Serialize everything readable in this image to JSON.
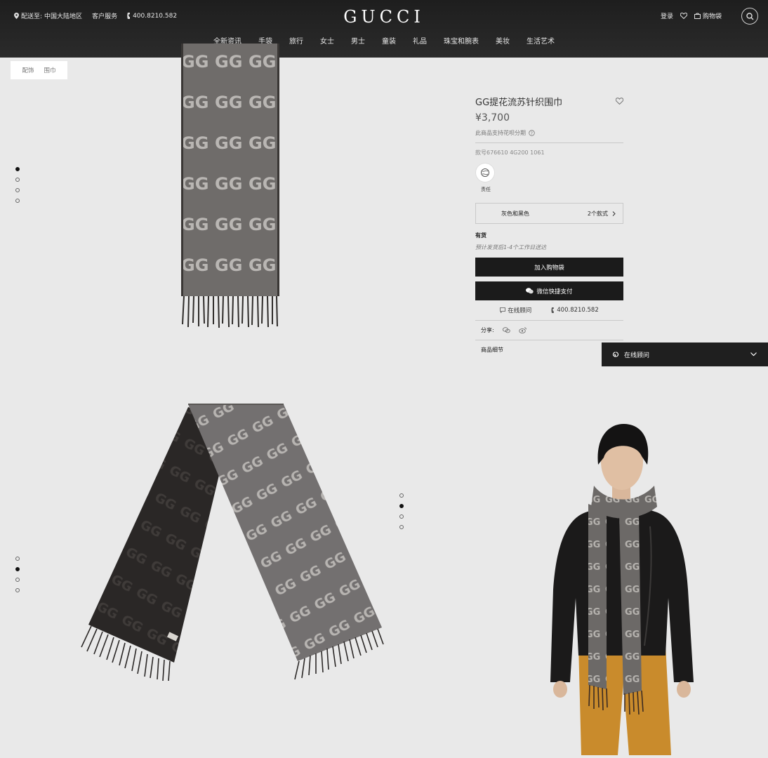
{
  "header": {
    "delivery_label": "配送至:",
    "delivery_region": "中国大陆地区",
    "customer_service": "客户服务",
    "phone": "400.8210.582",
    "logo": "GUCCI",
    "login": "登录",
    "bag": "购物袋"
  },
  "nav": [
    "全新资讯",
    "手袋",
    "旅行",
    "女士",
    "男士",
    "童装",
    "礼品",
    "珠宝和腕表",
    "美妆",
    "生活艺术"
  ],
  "breadcrumb": [
    "配饰",
    "围巾"
  ],
  "product": {
    "title": "GG提花流苏针织围巾",
    "price": "¥3,700",
    "installment": "此商品支持花呗分期",
    "sku": "款号676610 4G200 1061",
    "swatch_label": "责任",
    "variant_name": "灰色和黑色",
    "variant_count": "2个款式",
    "stock": "有货",
    "shipping": "预计发货后1-4个工作日送达",
    "add_to_bag": "加入购物袋",
    "wechat_pay": "微信快捷支付",
    "online_advisor": "在线顾问",
    "phone": "400.8210.582",
    "share_label": "分享:",
    "details_label": "商品细节"
  },
  "chat": {
    "label": "在线顾问"
  },
  "colors": {
    "header_bg": "#222222",
    "page_bg": "#e9e9e9",
    "button_bg": "#1b1b1b",
    "scarf_grey": "#7d7a77",
    "scarf_dark": "#262322",
    "jacket": "#1a1a1a",
    "trousers": "#c98b2c"
  },
  "gallery": {
    "top_active_index": 1,
    "mid_active_index": 2,
    "bottom_active_index": 2,
    "count": 4
  }
}
